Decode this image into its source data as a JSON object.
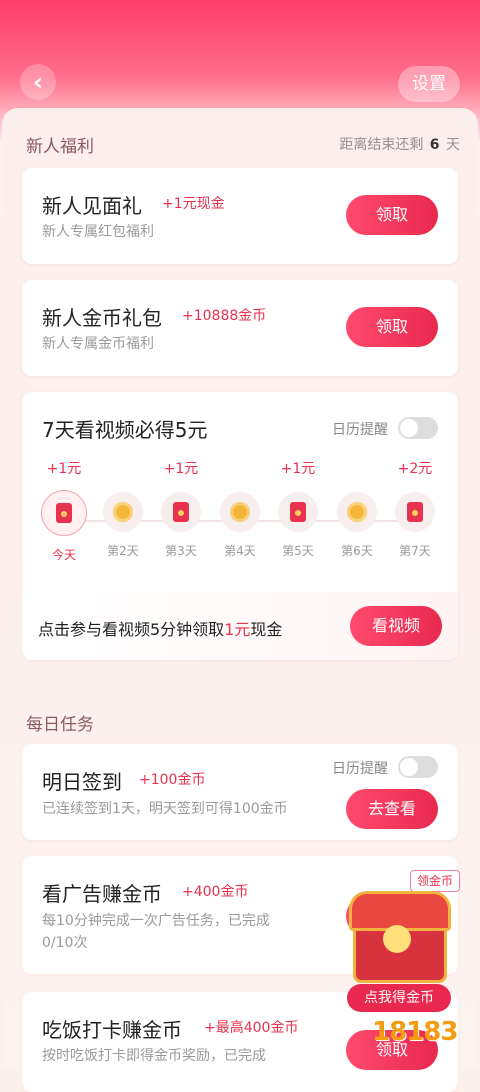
{
  "header": {
    "back_icon": "chevron-left-icon",
    "settings_label": "设置"
  },
  "newbie": {
    "title": "新人福利",
    "countdown_prefix": "距离结束还剩",
    "countdown_days": "6",
    "countdown_unit": "天",
    "cards": [
      {
        "title": "新人见面礼",
        "reward": "+1元现金",
        "sub": "新人专属红包福利",
        "button": "领取"
      },
      {
        "title": "新人金币礼包",
        "reward": "+10888金币",
        "sub": "新人专属金币福利",
        "button": "领取"
      }
    ]
  },
  "video_task": {
    "title": "7天看视频必得5元",
    "toggle_label": "日历提醒",
    "days": [
      {
        "amount": "+1元",
        "label": "今天",
        "icon": "red-envelope-icon"
      },
      {
        "amount": "",
        "label": "第2天",
        "icon": "coin-icon"
      },
      {
        "amount": "+1元",
        "label": "第3天",
        "icon": "red-envelope-icon"
      },
      {
        "amount": "",
        "label": "第4天",
        "icon": "coin-icon"
      },
      {
        "amount": "+1元",
        "label": "第5天",
        "icon": "red-envelope-icon"
      },
      {
        "amount": "",
        "label": "第6天",
        "icon": "coin-icon"
      },
      {
        "amount": "+2元",
        "label": "第7天",
        "icon": "red-envelope-icon"
      }
    ],
    "footer_prefix": "点击参与看视频5分钟领取",
    "footer_highlight": "1元",
    "footer_suffix": "现金",
    "button": "看视频"
  },
  "daily": {
    "title": "每日任务",
    "tasks": [
      {
        "title": "明日签到",
        "reward": "+100金币",
        "toggle_label": "日历提醒",
        "sub": "已连续签到1天，明天签到可得100金币",
        "button": "去查看"
      },
      {
        "title": "看广告赚金币",
        "reward": "+400金币",
        "sub_line1": "每10分钟完成一次广告任务，已完成",
        "sub_line2": "0/10次",
        "button": "领取",
        "tag": "领金币"
      },
      {
        "title": "吃饭打卡赚金币",
        "reward": "+最高400金币",
        "sub_line1": "按时吃饭打卡即得金币奖励，已完成",
        "button": "领取"
      }
    ]
  },
  "floating": {
    "chest_label": "点我得金币",
    "icon": "treasure-chest-icon"
  },
  "watermark": "18183",
  "colors": {
    "accent": "#e8324f",
    "hero_top": "#ff3d6a",
    "background": "#fdf1ee"
  }
}
